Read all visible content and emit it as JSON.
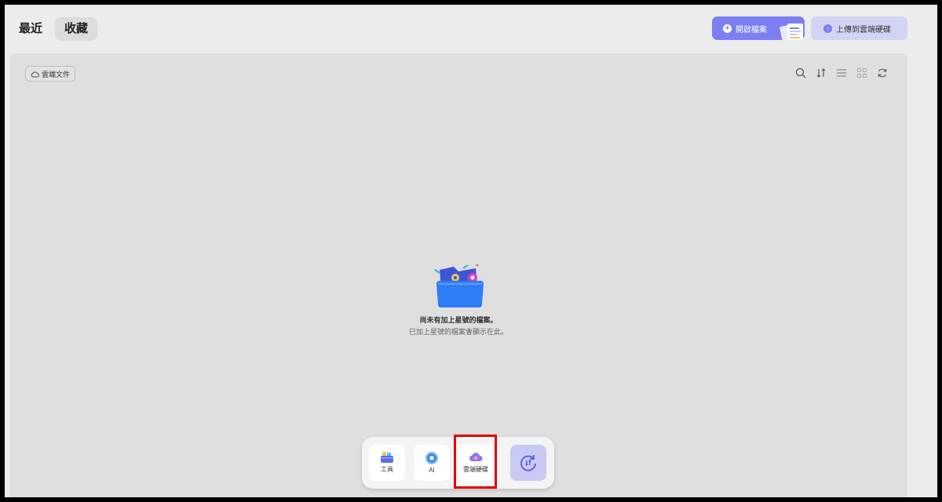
{
  "header": {
    "tab_recent": "最近",
    "tab_favorites": "收藏",
    "open_file_label": "開啟檔案",
    "upload_label": "上傳到雲端硬碟"
  },
  "panel": {
    "cloud_chip_label": "雲端文件",
    "toolbar_icons": [
      "search-icon",
      "sort-icon",
      "list-view-icon",
      "grid-view-icon",
      "refresh-icon"
    ],
    "empty_title": "尚未有加上星號的檔案。",
    "empty_subtitle": "已加上星號的檔案會顯示在此。"
  },
  "dock": {
    "tools_label": "工具",
    "ai_label": "AI",
    "cloud_label": "雲端硬碟"
  },
  "colors": {
    "accent": "#7b7ff2",
    "accent_light": "#d3d4f4",
    "highlight": "#e60000"
  }
}
